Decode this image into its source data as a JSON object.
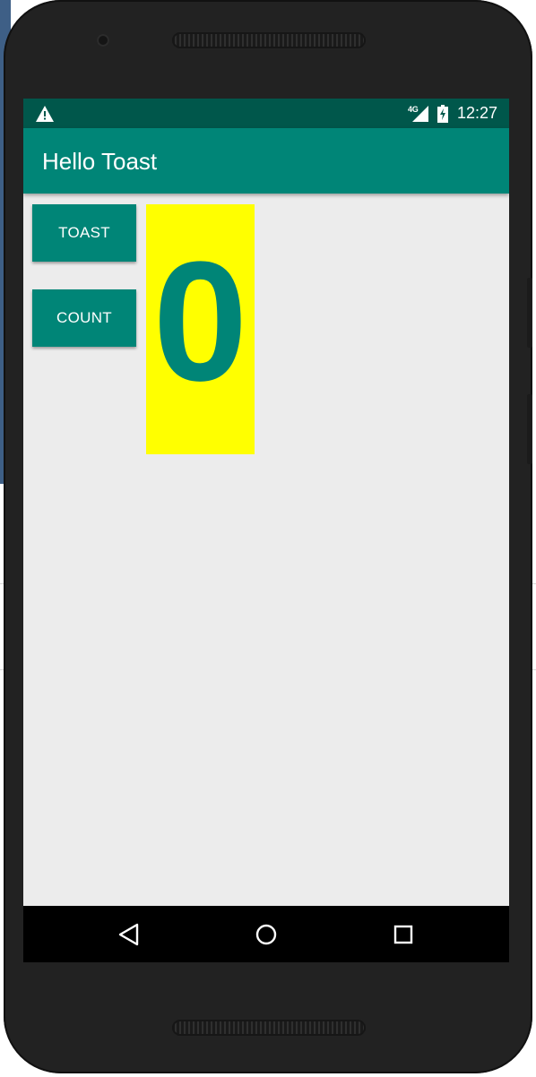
{
  "status_bar": {
    "network_label": "4G",
    "time": "12:27",
    "icons": [
      "warning-icon",
      "signal-icon",
      "battery-charging-icon"
    ]
  },
  "app_bar": {
    "title": "Hello Toast"
  },
  "buttons": {
    "toast_label": "TOAST",
    "count_label": "COUNT"
  },
  "counter": {
    "value": "0"
  },
  "nav_bar": {
    "icons": [
      "back-icon",
      "home-icon",
      "recents-icon"
    ]
  },
  "colors": {
    "primary": "#008577",
    "status_bar": "#00574b",
    "count_background": "#ffff00",
    "screen_background": "#ececec"
  }
}
